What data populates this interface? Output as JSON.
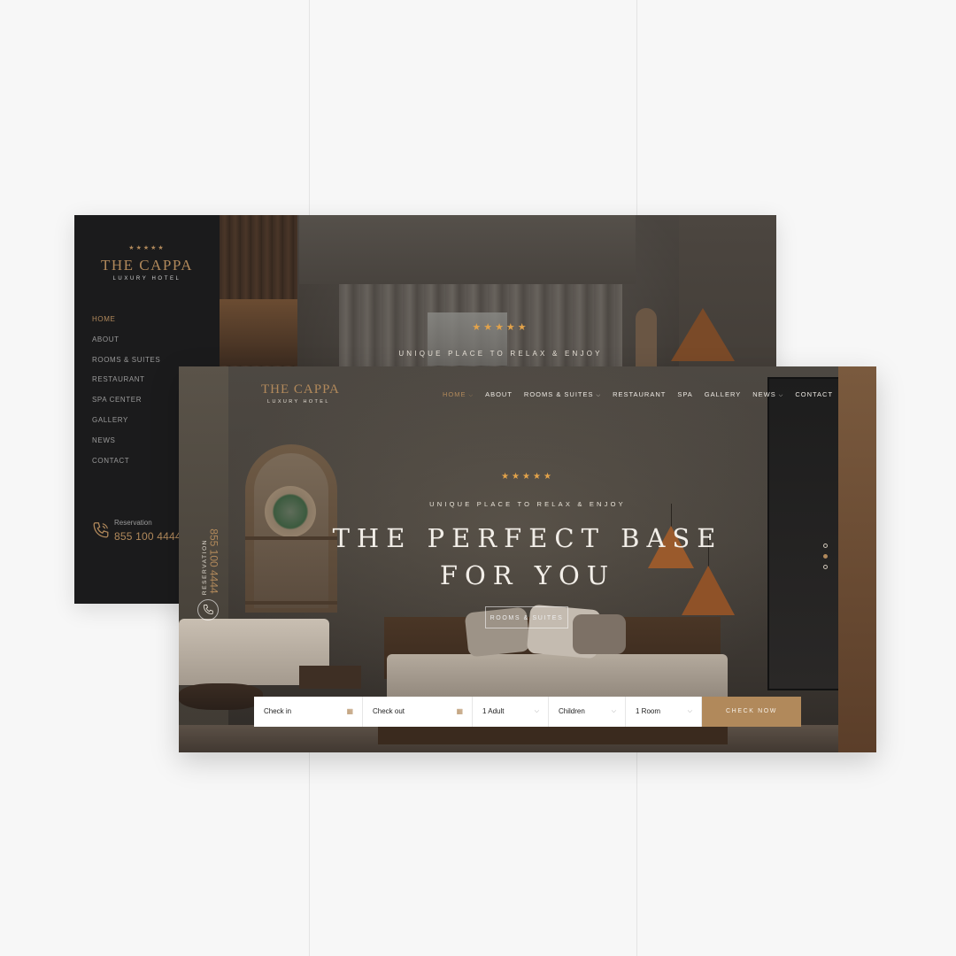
{
  "sidebar_layout": {
    "stars": "★★★★★",
    "logo": "THE CAPPA",
    "logo_sub": "LUXURY HOTEL",
    "nav": [
      "HOME",
      "ABOUT",
      "ROOMS & SUITES",
      "RESTAURANT",
      "SPA CENTER",
      "GALLERY",
      "NEWS",
      "CONTACT"
    ],
    "active_nav": "HOME",
    "reservation_label": "Reservation",
    "reservation_phone": "855 100 4444",
    "hero_stars": "★★★★★",
    "hero_tagline": "UNIQUE PLACE TO RELAX & ENJOY"
  },
  "header": {
    "logo": "THE CAPPA",
    "logo_sub": "LUXURY HOTEL",
    "nav": [
      {
        "label": "HOME",
        "dropdown": true,
        "active": true
      },
      {
        "label": "ABOUT",
        "dropdown": false
      },
      {
        "label": "ROOMS & SUITES",
        "dropdown": true
      },
      {
        "label": "RESTAURANT",
        "dropdown": false
      },
      {
        "label": "SPA",
        "dropdown": false
      },
      {
        "label": "GALLERY",
        "dropdown": false
      },
      {
        "label": "NEWS",
        "dropdown": true
      },
      {
        "label": "CONTACT",
        "dropdown": false
      }
    ]
  },
  "hero": {
    "stars": "★★★★★",
    "tagline": "UNIQUE PLACE TO RELAX & ENJOY",
    "title_line1": "THE PERFECT BASE",
    "title_line2": "FOR YOU",
    "cta": "ROOMS & SUITES",
    "slider_dots": 3,
    "active_dot": 2
  },
  "side_reservation": {
    "label": "RESERVATION",
    "phone": "855 100 4444"
  },
  "booking": {
    "check_in": "Check in",
    "check_out": "Check out",
    "adults": "1 Adult",
    "children": "Children",
    "rooms": "1 Room",
    "submit": "CHECK NOW"
  },
  "colors": {
    "accent_gold": "#b1895b",
    "star_orange": "#e3a34a",
    "sidebar_bg": "#1b1b1c",
    "page_bg": "#f7f7f7"
  },
  "icons": {
    "phone": "phone-icon",
    "calendar": "calendar-icon",
    "chevron": "chevron-down-icon"
  }
}
